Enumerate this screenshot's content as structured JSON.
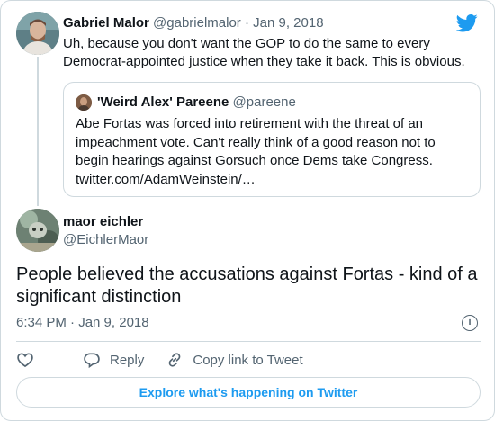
{
  "brand": {
    "accent": "#1d9bf0",
    "icon": "twitter-bird-icon"
  },
  "parent_tweet": {
    "name": "Gabriel Malor",
    "handle": "@gabrielmalor",
    "separator": "·",
    "date": "Jan 9, 2018",
    "text": "Uh, because you don't want the GOP to do the same to every Democrat-appointed justice when they take it back. This is obvious."
  },
  "quoted_tweet": {
    "name": "'Weird Alex' Pareene",
    "handle": "@pareene",
    "text": "Abe Fortas was forced into retirement with the threat of an impeachment vote. Can't really think of a good reason not to begin hearings against Gorsuch once Dems take Congress. twitter.com/AdamWeinstein/…"
  },
  "main_tweet": {
    "name": "maor eichler",
    "handle": "@EichlerMaor",
    "text": "People believed the accusations against Fortas - kind of a significant distinction",
    "timestamp": "6:34 PM · Jan 9, 2018"
  },
  "actions": {
    "like_icon": "heart-icon",
    "reply_icon": "reply-bubble-icon",
    "reply_label": "Reply",
    "copy_icon": "link-icon",
    "copy_label": "Copy link to Tweet"
  },
  "explore_label": "Explore what's happening on Twitter"
}
